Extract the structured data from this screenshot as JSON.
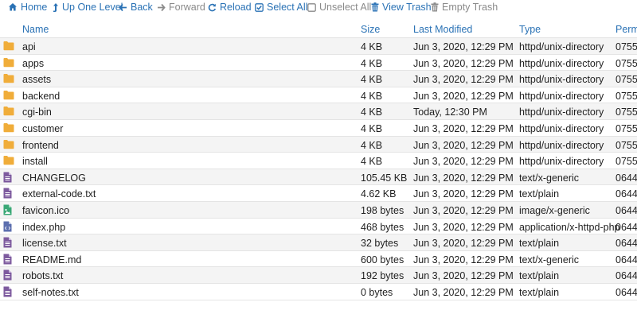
{
  "toolbar": {
    "home": "Home",
    "up_one_level": "Up One Level",
    "back": "Back",
    "forward": "Forward",
    "reload": "Reload",
    "select_all": "Select All",
    "unselect_all": "Unselect All",
    "view_trash": "View Trash",
    "empty_trash": "Empty Trash"
  },
  "columns": {
    "name": "Name",
    "size": "Size",
    "last_modified": "Last Modified",
    "type": "Type",
    "permissions": "Permis"
  },
  "colors": {
    "accent": "#2a72b5",
    "folder": "#f0ad3a",
    "file": "#7d5a9e",
    "image_file": "#3aa876",
    "code_file": "#5b6eae"
  },
  "files": [
    {
      "icon": "folder-icon",
      "name": "api",
      "size": "4 KB",
      "modified": "Jun 3, 2020, 12:29 PM",
      "type": "httpd/unix-directory",
      "perms": "0755"
    },
    {
      "icon": "folder-icon",
      "name": "apps",
      "size": "4 KB",
      "modified": "Jun 3, 2020, 12:29 PM",
      "type": "httpd/unix-directory",
      "perms": "0755"
    },
    {
      "icon": "folder-icon",
      "name": "assets",
      "size": "4 KB",
      "modified": "Jun 3, 2020, 12:29 PM",
      "type": "httpd/unix-directory",
      "perms": "0755"
    },
    {
      "icon": "folder-icon",
      "name": "backend",
      "size": "4 KB",
      "modified": "Jun 3, 2020, 12:29 PM",
      "type": "httpd/unix-directory",
      "perms": "0755"
    },
    {
      "icon": "folder-icon",
      "name": "cgi-bin",
      "size": "4 KB",
      "modified": "Today, 12:30 PM",
      "type": "httpd/unix-directory",
      "perms": "0755"
    },
    {
      "icon": "folder-icon",
      "name": "customer",
      "size": "4 KB",
      "modified": "Jun 3, 2020, 12:29 PM",
      "type": "httpd/unix-directory",
      "perms": "0755"
    },
    {
      "icon": "folder-icon",
      "name": "frontend",
      "size": "4 KB",
      "modified": "Jun 3, 2020, 12:29 PM",
      "type": "httpd/unix-directory",
      "perms": "0755"
    },
    {
      "icon": "folder-icon",
      "name": "install",
      "size": "4 KB",
      "modified": "Jun 3, 2020, 12:29 PM",
      "type": "httpd/unix-directory",
      "perms": "0755"
    },
    {
      "icon": "text-file-icon",
      "name": "CHANGELOG",
      "size": "105.45 KB",
      "modified": "Jun 3, 2020, 12:29 PM",
      "type": "text/x-generic",
      "perms": "0644"
    },
    {
      "icon": "text-file-icon",
      "name": "external-code.txt",
      "size": "4.62 KB",
      "modified": "Jun 3, 2020, 12:29 PM",
      "type": "text/plain",
      "perms": "0644"
    },
    {
      "icon": "image-file-icon",
      "name": "favicon.ico",
      "size": "198 bytes",
      "modified": "Jun 3, 2020, 12:29 PM",
      "type": "image/x-generic",
      "perms": "0644"
    },
    {
      "icon": "code-file-icon",
      "name": "index.php",
      "size": "468 bytes",
      "modified": "Jun 3, 2020, 12:29 PM",
      "type": "application/x-httpd-php",
      "perms": "0644"
    },
    {
      "icon": "text-file-icon",
      "name": "license.txt",
      "size": "32 bytes",
      "modified": "Jun 3, 2020, 12:29 PM",
      "type": "text/plain",
      "perms": "0644"
    },
    {
      "icon": "text-file-icon",
      "name": "README.md",
      "size": "600 bytes",
      "modified": "Jun 3, 2020, 12:29 PM",
      "type": "text/x-generic",
      "perms": "0644"
    },
    {
      "icon": "text-file-icon",
      "name": "robots.txt",
      "size": "192 bytes",
      "modified": "Jun 3, 2020, 12:29 PM",
      "type": "text/plain",
      "perms": "0644"
    },
    {
      "icon": "text-file-icon",
      "name": "self-notes.txt",
      "size": "0 bytes",
      "modified": "Jun 3, 2020, 12:29 PM",
      "type": "text/plain",
      "perms": "0644"
    }
  ]
}
